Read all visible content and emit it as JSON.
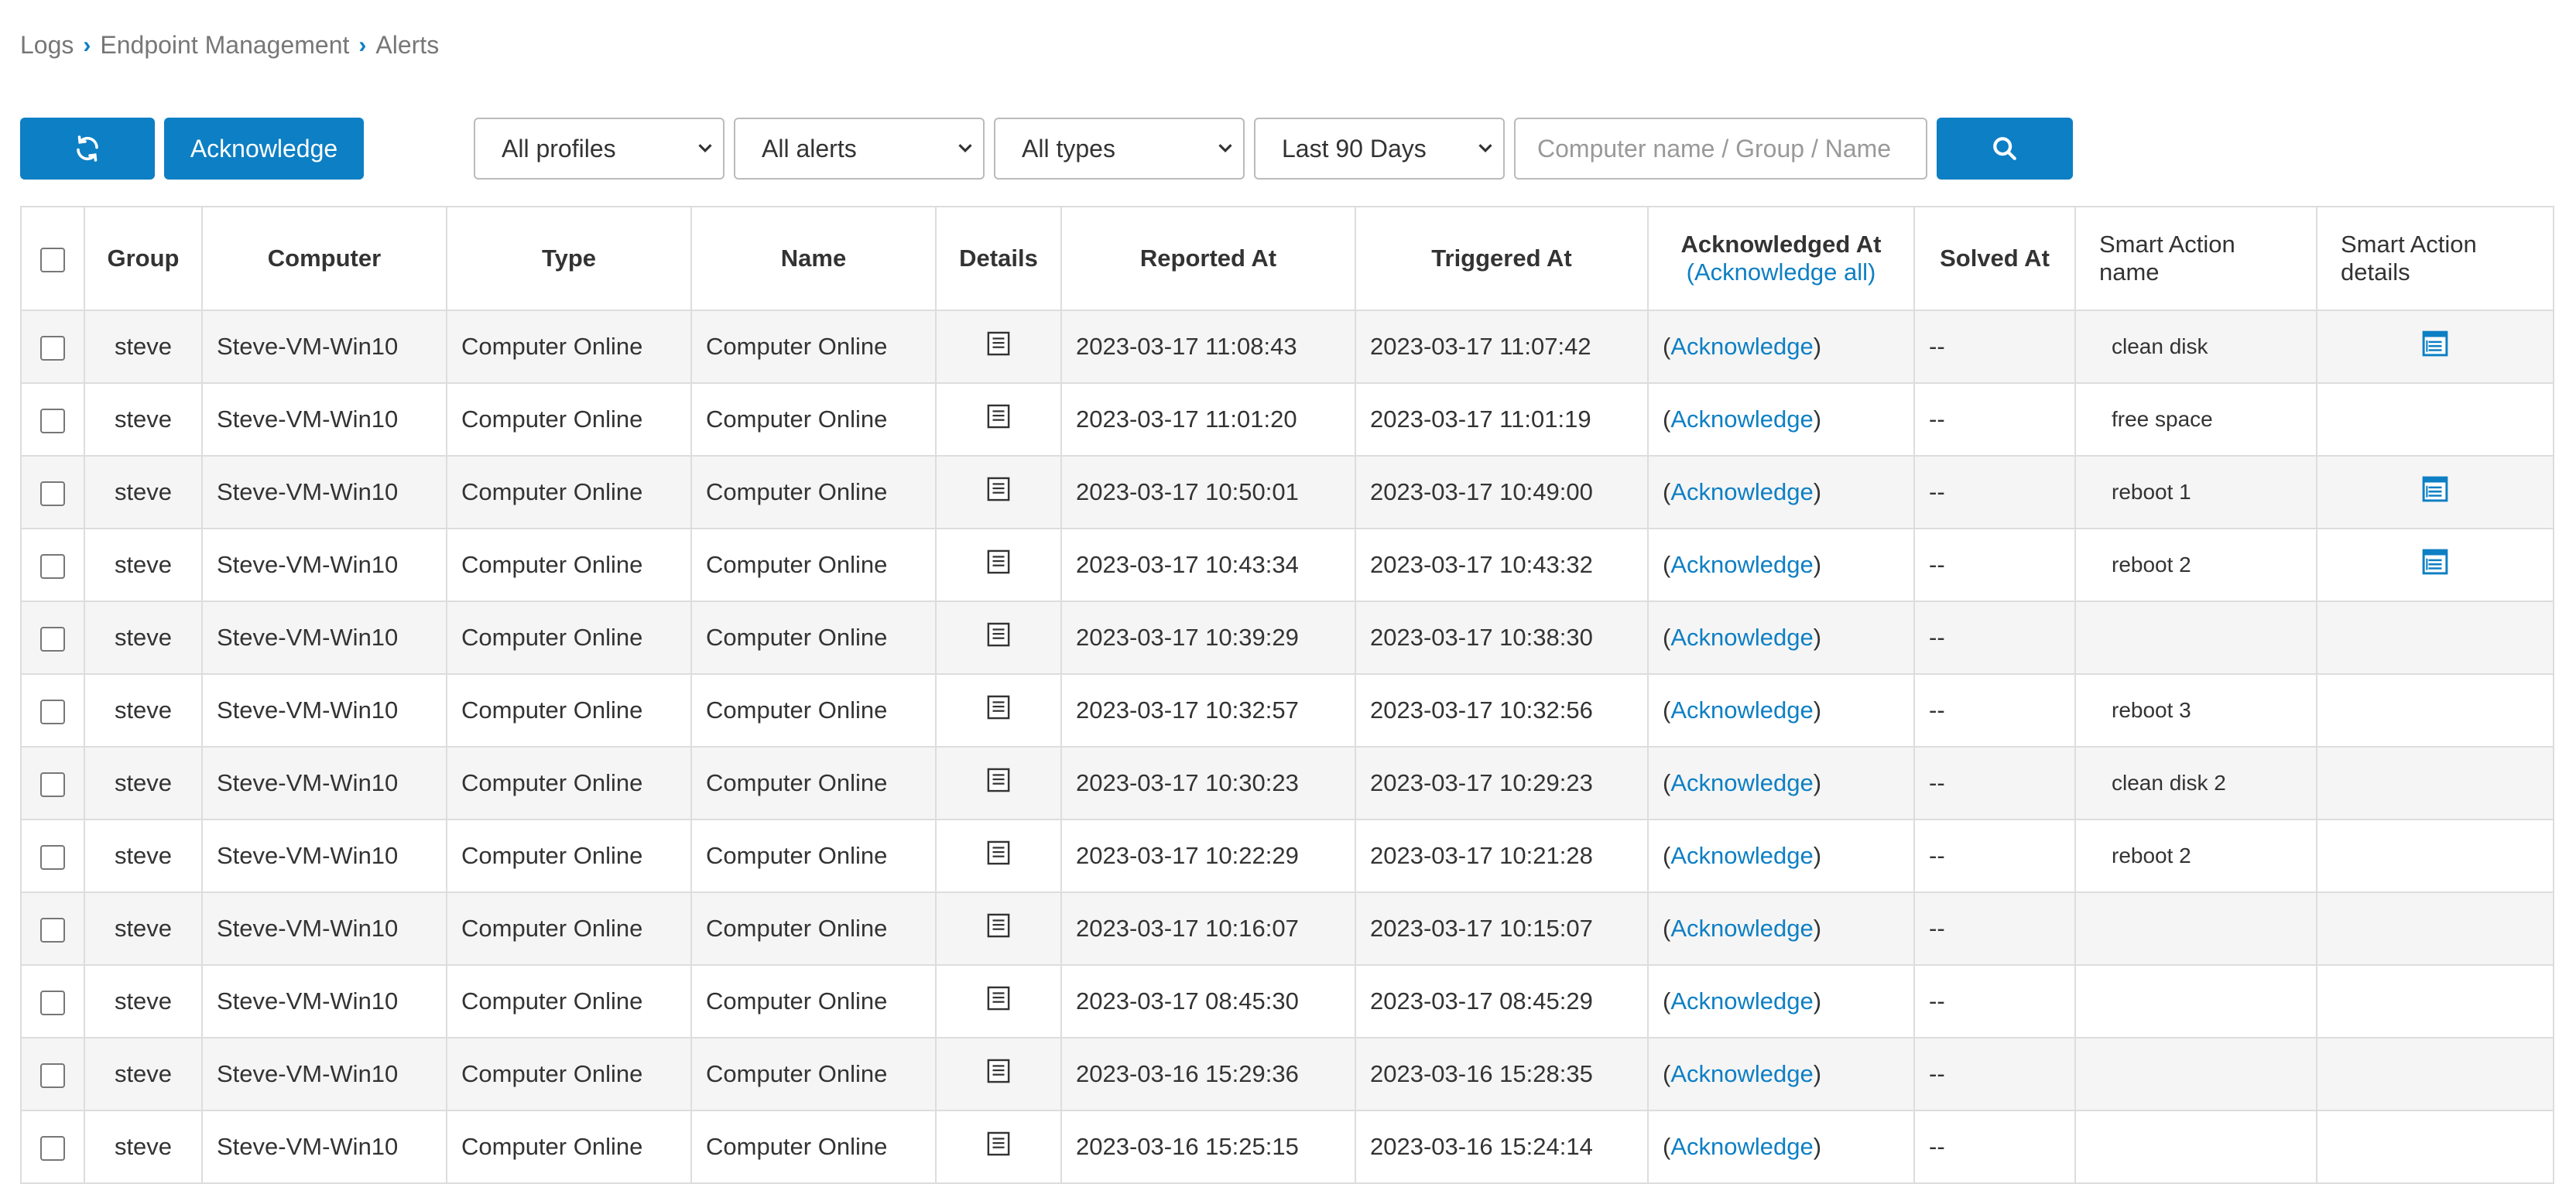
{
  "breadcrumb": [
    "Logs",
    "Endpoint Management",
    "Alerts"
  ],
  "toolbar": {
    "refresh_icon": "refresh-icon",
    "acknowledge_label": "Acknowledge",
    "profiles": "All profiles",
    "alerts": "All alerts",
    "types": "All types",
    "period": "Last 90 Days",
    "search_placeholder": "Computer name / Group / Name",
    "search_icon": "search-icon"
  },
  "table": {
    "headers": {
      "group": "Group",
      "computer": "Computer",
      "type": "Type",
      "name": "Name",
      "details": "Details",
      "reported_at": "Reported At",
      "triggered_at": "Triggered At",
      "acknowledged_at": "Acknowledged At",
      "acknowledge_all": "(Acknowledge all)",
      "solved_at": "Solved At",
      "smart_action_name_1": "Smart Action",
      "smart_action_name_2": "name",
      "smart_action_details_1": "Smart Action",
      "smart_action_details_2": "details"
    },
    "acknowledge_link": "Acknowledge",
    "rows": [
      {
        "group": "steve",
        "computer": "Steve-VM-Win10",
        "type": "Computer Online",
        "name": "Computer Online",
        "reported": "2023-03-17 11:08:43",
        "triggered": "2023-03-17 11:07:42",
        "solved": "--",
        "sa_name": "clean disk",
        "sa_details": true
      },
      {
        "group": "steve",
        "computer": "Steve-VM-Win10",
        "type": "Computer Online",
        "name": "Computer Online",
        "reported": "2023-03-17 11:01:20",
        "triggered": "2023-03-17 11:01:19",
        "solved": "--",
        "sa_name": "free space",
        "sa_details": false
      },
      {
        "group": "steve",
        "computer": "Steve-VM-Win10",
        "type": "Computer Online",
        "name": "Computer Online",
        "reported": "2023-03-17 10:50:01",
        "triggered": "2023-03-17 10:49:00",
        "solved": "--",
        "sa_name": "reboot 1",
        "sa_details": true
      },
      {
        "group": "steve",
        "computer": "Steve-VM-Win10",
        "type": "Computer Online",
        "name": "Computer Online",
        "reported": "2023-03-17 10:43:34",
        "triggered": "2023-03-17 10:43:32",
        "solved": "--",
        "sa_name": "reboot 2",
        "sa_details": true
      },
      {
        "group": "steve",
        "computer": "Steve-VM-Win10",
        "type": "Computer Online",
        "name": "Computer Online",
        "reported": "2023-03-17 10:39:29",
        "triggered": "2023-03-17 10:38:30",
        "solved": "--",
        "sa_name": "",
        "sa_details": false
      },
      {
        "group": "steve",
        "computer": "Steve-VM-Win10",
        "type": "Computer Online",
        "name": "Computer Online",
        "reported": "2023-03-17 10:32:57",
        "triggered": "2023-03-17 10:32:56",
        "solved": "--",
        "sa_name": "reboot 3",
        "sa_details": false
      },
      {
        "group": "steve",
        "computer": "Steve-VM-Win10",
        "type": "Computer Online",
        "name": "Computer Online",
        "reported": "2023-03-17 10:30:23",
        "triggered": "2023-03-17 10:29:23",
        "solved": "--",
        "sa_name": "clean disk 2",
        "sa_details": false
      },
      {
        "group": "steve",
        "computer": "Steve-VM-Win10",
        "type": "Computer Online",
        "name": "Computer Online",
        "reported": "2023-03-17 10:22:29",
        "triggered": "2023-03-17 10:21:28",
        "solved": "--",
        "sa_name": "reboot 2",
        "sa_details": false
      },
      {
        "group": "steve",
        "computer": "Steve-VM-Win10",
        "type": "Computer Online",
        "name": "Computer Online",
        "reported": "2023-03-17 10:16:07",
        "triggered": "2023-03-17 10:15:07",
        "solved": "--",
        "sa_name": "",
        "sa_details": false
      },
      {
        "group": "steve",
        "computer": "Steve-VM-Win10",
        "type": "Computer Online",
        "name": "Computer Online",
        "reported": "2023-03-17 08:45:30",
        "triggered": "2023-03-17 08:45:29",
        "solved": "--",
        "sa_name": "",
        "sa_details": false
      },
      {
        "group": "steve",
        "computer": "Steve-VM-Win10",
        "type": "Computer Online",
        "name": "Computer Online",
        "reported": "2023-03-16 15:29:36",
        "triggered": "2023-03-16 15:28:35",
        "solved": "--",
        "sa_name": "",
        "sa_details": false
      },
      {
        "group": "steve",
        "computer": "Steve-VM-Win10",
        "type": "Computer Online",
        "name": "Computer Online",
        "reported": "2023-03-16 15:25:15",
        "triggered": "2023-03-16 15:24:14",
        "solved": "--",
        "sa_name": "",
        "sa_details": false
      }
    ]
  },
  "colors": {
    "accent": "#0d7fc4",
    "row_alt": "#f5f5f5",
    "border": "#dddddd"
  }
}
